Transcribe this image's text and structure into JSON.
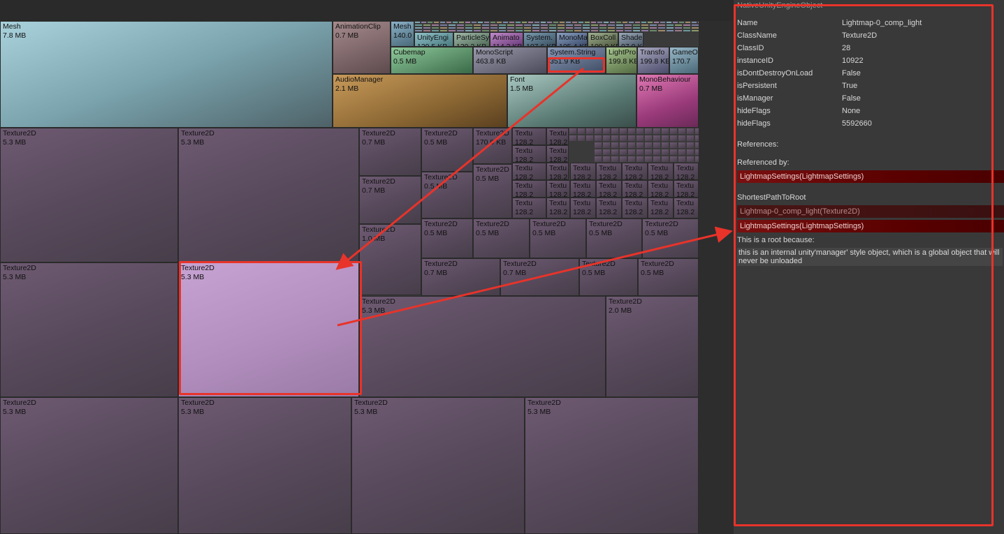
{
  "colors": {
    "highlight": "#e8332a",
    "reference_bar": "#6a0000",
    "texture2d": "#5e5062",
    "texture2d_selected": "#b493c0"
  },
  "inspector": {
    "header": "NativeUnityEngineObject",
    "props": [
      {
        "k": "Name",
        "v": "Lightmap-0_comp_light"
      },
      {
        "k": "ClassName",
        "v": "Texture2D"
      },
      {
        "k": "ClassID",
        "v": "28"
      },
      {
        "k": "instanceID",
        "v": "10922"
      },
      {
        "k": "isDontDestroyOnLoad",
        "v": "False"
      },
      {
        "k": "isPersistent",
        "v": "True"
      },
      {
        "k": "isManager",
        "v": "False"
      },
      {
        "k": "hideFlags",
        "v": "None"
      },
      {
        "k": "hideFlags",
        "v": "5592660"
      }
    ],
    "references_label": "References:",
    "referenced_by_label": "Referenced by:",
    "referenced_by": [
      "LightmapSettings(LightmapSettings)"
    ],
    "shortest_path_label": "ShortestPathToRoot",
    "shortest_path": [
      "Lightmap-0_comp_light(Texture2D)",
      "LightmapSettings(LightmapSettings)"
    ],
    "root_reason_label": "This is a root because:",
    "root_reason": "this is an internal unity'manager' style object, which is a global object that will never be unloaded"
  },
  "treemap": {
    "cells": [
      {
        "name": "Mesh",
        "size": "7.8 MB"
      },
      {
        "name": "AnimationClip",
        "size": "0.7 MB"
      },
      {
        "name": "Mesh",
        "size": "140.0"
      },
      {
        "name": "UnityEngi",
        "size": "139.5 KB"
      },
      {
        "name": "ParticleSy",
        "size": "139.2 KB"
      },
      {
        "name": "Animato",
        "size": "114.2 KB"
      },
      {
        "name": "System.",
        "size": "107.6 KB"
      },
      {
        "name": "MonoMa",
        "size": "105.4 KB"
      },
      {
        "name": "BoxColl",
        "size": "100.0 KB"
      },
      {
        "name": "Shade",
        "size": "97.9 KB"
      },
      {
        "name": "Cubemap",
        "size": "0.5 MB"
      },
      {
        "name": "MonoScript",
        "size": "463.8 KB"
      },
      {
        "name": "System.String",
        "size": "351.9 KB"
      },
      {
        "name": "LightPro",
        "size": "199.8 KB"
      },
      {
        "name": "Transfo",
        "size": "199.8 KB"
      },
      {
        "name": "GameO",
        "size": "170.7"
      },
      {
        "name": "AudioManager",
        "size": "2.1 MB"
      },
      {
        "name": "Font",
        "size": "1.5 MB"
      },
      {
        "name": "MonoBehaviour",
        "size": "0.7 MB"
      },
      {
        "name": "Texture2D",
        "size": "5.3 MB"
      },
      {
        "name": "Texture2D",
        "size": "5.3 MB"
      },
      {
        "name": "Texture2D",
        "size": "0.7 MB"
      },
      {
        "name": "Texture2D",
        "size": "0.5 MB"
      },
      {
        "name": "Texture2D",
        "size": "170.9 KB"
      },
      {
        "name": "Texture2D",
        "size": "0.5 MB"
      },
      {
        "name": "Texture2D",
        "size": "0.7 MB"
      },
      {
        "name": "Texture2D",
        "size": "0.5 MB"
      },
      {
        "name": "Texture2D",
        "size": "1.0 MB"
      },
      {
        "name": "Texture2D",
        "size": "0.5 MB"
      },
      {
        "name": "Texture2D",
        "size": "0.5 MB"
      },
      {
        "name": "Texture2D",
        "size": "0.5 MB"
      },
      {
        "name": "Texture2D",
        "size": "0.5 MB"
      },
      {
        "name": "Texture2D",
        "size": "0.5 MB"
      },
      {
        "name": "Texture2D",
        "size": "0.7 MB"
      },
      {
        "name": "Texture2D",
        "size": "0.7 MB"
      },
      {
        "name": "Texture2D",
        "size": "0.5 MB"
      },
      {
        "name": "Texture2D",
        "size": "0.5 MB"
      },
      {
        "name": "Texture2D",
        "size": "5.3 MB"
      },
      {
        "name": "Texture2D",
        "size": "5.3 MB"
      },
      {
        "name": "Texture2D",
        "size": "5.3 MB"
      },
      {
        "name": "Texture2D",
        "size": "2.0 MB"
      },
      {
        "name": "Texture2D",
        "size": "5.3 MB"
      },
      {
        "name": "Texture2D",
        "size": "5.3 MB"
      },
      {
        "name": "Texture2D",
        "size": "5.3 MB"
      },
      {
        "name": "Texture2D",
        "size": "5.3 MB"
      },
      {
        "name": "Textu",
        "size": "128.2"
      },
      {
        "name": "Textu",
        "size": "128.2"
      },
      {
        "name": "Textu",
        "size": "128.2"
      },
      {
        "name": "Textu",
        "size": "128.2"
      },
      {
        "name": "Textu",
        "size": "128.2"
      },
      {
        "name": "Textu",
        "size": "128.2"
      },
      {
        "name": "Textu",
        "size": "128.2"
      },
      {
        "name": "Textu",
        "size": "128.2"
      },
      {
        "name": "Textu",
        "size": "128.2"
      },
      {
        "name": "Textu",
        "size": "128.2"
      },
      {
        "name": "Textu",
        "size": "128.2"
      },
      {
        "name": "Textu",
        "size": "128.2"
      },
      {
        "name": "Textu",
        "size": "128.2"
      },
      {
        "name": "Textu",
        "size": "128.2"
      },
      {
        "name": "Textu",
        "size": "128.2"
      },
      {
        "name": "Textu",
        "size": "128.2"
      },
      {
        "name": "Textu",
        "size": "128.2"
      },
      {
        "name": "Textu",
        "size": "128.2"
      },
      {
        "name": "Textu",
        "size": "128.2"
      },
      {
        "name": "Textu",
        "size": "128.2"
      },
      {
        "name": "Textu",
        "size": "128.2"
      },
      {
        "name": "Textu",
        "size": "128.2"
      },
      {
        "name": "Textu",
        "size": "128.2"
      },
      {
        "name": "Textu",
        "size": "128.2"
      },
      {
        "name": "Textu",
        "size": "128.2"
      },
      {
        "name": "Textu",
        "size": "128.2"
      },
      {
        "name": "Texture2",
        "size": "128.2 KB"
      },
      {
        "name": "Texture2",
        "size": "79.2"
      },
      {
        "name": "Textu",
        "size": ""
      },
      {
        "name": "Textu",
        "size": ""
      }
    ]
  }
}
